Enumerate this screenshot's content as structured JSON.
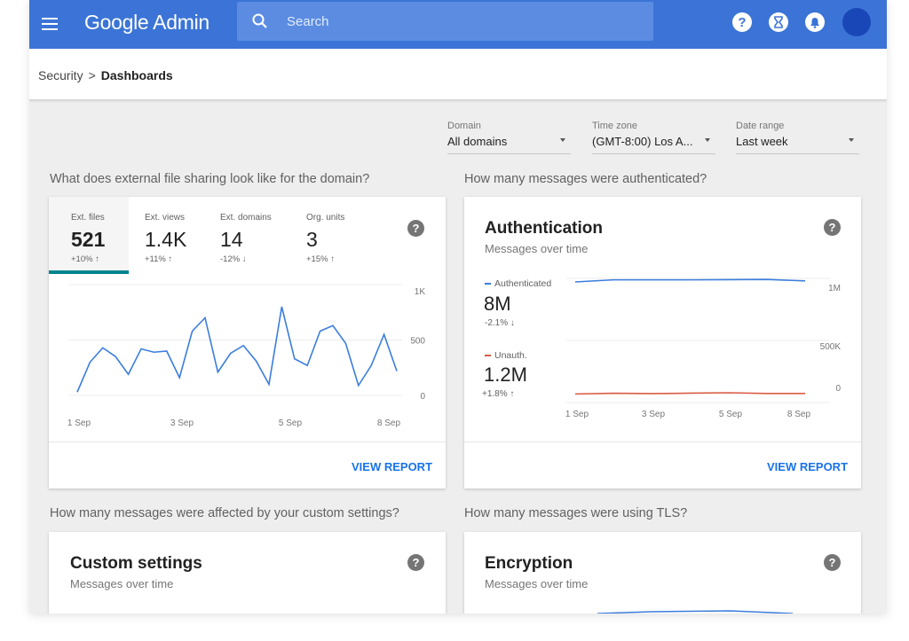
{
  "app": {
    "title": "Google Admin"
  },
  "search": {
    "placeholder": "Search"
  },
  "breadcrumb": {
    "parent": "Security",
    "separator": ">",
    "current": "Dashboards"
  },
  "filters": [
    {
      "label": "Domain",
      "value": "All domains"
    },
    {
      "label": "Time zone",
      "value": "(GMT-8:00) Los A..."
    },
    {
      "label": "Date range",
      "value": "Last week"
    }
  ],
  "sharing": {
    "question": "What does external file sharing look like for the domain?",
    "tabs": [
      {
        "label": "Ext. files",
        "value": "521",
        "delta": "+10% ↑"
      },
      {
        "label": "Ext. views",
        "value": "1.4K",
        "delta": "+11% ↑"
      },
      {
        "label": "Ext. domains",
        "value": "14",
        "delta": "-12% ↓"
      },
      {
        "label": "Org. units",
        "value": "3",
        "delta": "+15% ↑"
      }
    ],
    "report_label": "VIEW REPORT"
  },
  "auth": {
    "question": "How many messages were authenticated?",
    "title": "Authentication",
    "subtitle": "Messages over time",
    "series": [
      {
        "name": "Authenticated",
        "value": "8M",
        "delta": "-2.1% ↓",
        "color": "#3b7ddd"
      },
      {
        "name": "Unauth.",
        "value": "1.2M",
        "delta": "+1.8% ↑",
        "color": "#d95b43"
      }
    ],
    "report_label": "VIEW REPORT"
  },
  "custom": {
    "question": "How many messages were affected by your custom settings?",
    "title": "Custom settings",
    "subtitle": "Messages over time"
  },
  "encryption": {
    "question": "How many messages were using TLS?",
    "title": "Encryption",
    "subtitle": "Messages over time"
  },
  "icons": {
    "help": "?",
    "menu": "menu-icon",
    "search": "search-icon",
    "apps": "apps-icon",
    "bell": "bell-icon"
  },
  "chart_data": [
    {
      "type": "line",
      "x": [
        "1 Sep",
        "",
        "",
        "",
        "",
        "",
        "",
        "",
        "",
        "",
        "",
        "3 Sep",
        "",
        "",
        "",
        "",
        "",
        "",
        "",
        "",
        "",
        "5 Sep",
        "",
        "",
        "",
        "",
        "",
        "",
        "",
        "",
        "8 Sep"
      ],
      "series": [
        {
          "values": [
            30,
            300,
            430,
            350,
            190,
            420,
            390,
            400,
            160,
            580,
            700,
            210,
            380,
            450,
            310,
            100,
            800,
            330,
            270,
            580,
            630,
            470,
            90,
            270,
            550,
            220
          ]
        }
      ],
      "xticks": [
        "1 Sep",
        "3 Sep",
        "5 Sep",
        "8 Sep"
      ],
      "yticks": [
        "1K",
        "500",
        "0"
      ],
      "ylim": [
        0,
        1000
      ]
    },
    {
      "type": "line",
      "xticks": [
        "1 Sep",
        "3 Sep",
        "5 Sep",
        "8 Sep"
      ],
      "yticks": [
        "1M",
        "500K",
        "0"
      ],
      "ylim": [
        0,
        1100000
      ],
      "series": [
        {
          "name": "Authenticated",
          "values": [
            990000,
            1010000,
            1010000,
            1010000,
            1012000,
            1014000,
            1000000
          ]
        },
        {
          "name": "Unauth.",
          "values": [
            45000,
            55000,
            50000,
            56000,
            62000,
            52000,
            52000
          ]
        }
      ]
    }
  ]
}
